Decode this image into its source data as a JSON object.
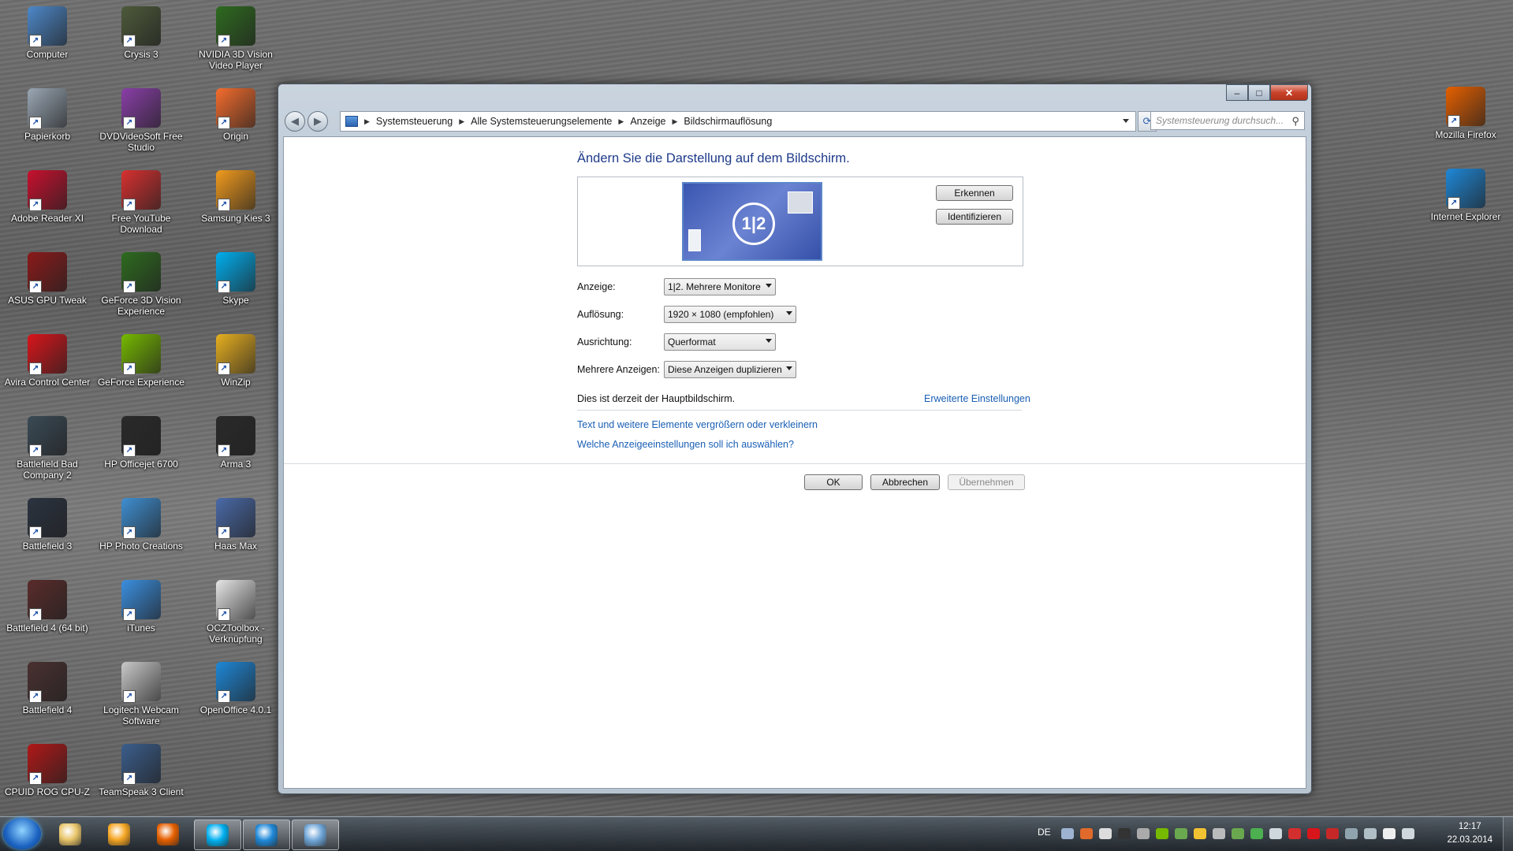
{
  "desktop": {
    "icons_col1": [
      {
        "label": "Computer",
        "icon": "computer-icon",
        "color": "#4d88c9"
      },
      {
        "label": "Papierkorb",
        "icon": "recycle-bin-icon",
        "color": "#9aa7b4"
      },
      {
        "label": "Adobe Reader XI",
        "icon": "adobe-reader-icon",
        "color": "#c8102e"
      },
      {
        "label": "ASUS GPU Tweak",
        "icon": "asus-gpu-tweak-icon",
        "color": "#8b1a1a"
      },
      {
        "label": "Avira Control Center",
        "icon": "avira-icon",
        "color": "#d8151b"
      },
      {
        "label": "Battlefield Bad Company 2",
        "icon": "battlefield-bc2-icon",
        "color": "#3a4a55"
      },
      {
        "label": "Battlefield 3",
        "icon": "battlefield-3-icon",
        "color": "#2a3340"
      },
      {
        "label": "Battlefield 4 (64 bit)",
        "icon": "battlefield-4-64-icon",
        "color": "#5a2b2b"
      },
      {
        "label": "Battlefield 4",
        "icon": "battlefield-4-icon",
        "color": "#4a3030"
      },
      {
        "label": "CPUID ROG CPU-Z",
        "icon": "cpuz-icon",
        "color": "#b01818"
      }
    ],
    "icons_col2": [
      {
        "label": "Crysis 3",
        "icon": "crysis-3-icon",
        "color": "#4d5a3a"
      },
      {
        "label": "DVDVideoSoft Free Studio",
        "icon": "dvdvideosoft-icon",
        "color": "#8a3fa8"
      },
      {
        "label": "Free YouTube Download",
        "icon": "youtube-download-icon",
        "color": "#d83030"
      },
      {
        "label": "GeForce 3D Vision Experience",
        "icon": "geforce-3d-vision-icon",
        "color": "#2e6b1f"
      },
      {
        "label": "GeForce Experience",
        "icon": "geforce-experience-icon",
        "color": "#76b900"
      },
      {
        "label": "HP Officejet 6700",
        "icon": "printer-icon",
        "color": "#2a2a2a"
      },
      {
        "label": "HP Photo Creations",
        "icon": "hp-photo-icon",
        "color": "#3f8fd2"
      },
      {
        "label": "iTunes",
        "icon": "itunes-icon",
        "color": "#3b8fe0"
      },
      {
        "label": "Logitech Webcam Software",
        "icon": "webcam-icon",
        "color": "#c9c9c9"
      },
      {
        "label": "TeamSpeak 3 Client",
        "icon": "teamspeak-icon",
        "color": "#3b5e8c"
      }
    ],
    "icons_col3": [
      {
        "label": "NVIDIA 3D Vision Video Player",
        "icon": "nvidia-3d-player-icon",
        "color": "#2e6b1f"
      },
      {
        "label": "Origin",
        "icon": "origin-icon",
        "color": "#f56c2d"
      },
      {
        "label": "Samsung Kies 3",
        "icon": "kies-icon",
        "color": "#f29b1d"
      },
      {
        "label": "Skype",
        "icon": "skype-icon",
        "color": "#00aff0"
      },
      {
        "label": "WinZip",
        "icon": "winzip-icon",
        "color": "#e8b020"
      },
      {
        "label": "Arma 3",
        "icon": "arma-3-icon",
        "color": "#2a2a2a"
      },
      {
        "label": "Haas Max",
        "icon": "haas-max-icon",
        "color": "#4a6aa8"
      },
      {
        "label": "OCZToolbox - Verknüpfung",
        "icon": "ocz-toolbox-icon",
        "color": "#e6e6e6"
      },
      {
        "label": "OpenOffice 4.0.1",
        "icon": "openoffice-icon",
        "color": "#1e88d8"
      }
    ],
    "icons_right": [
      {
        "label": "Mozilla Firefox",
        "icon": "firefox-icon",
        "color": "#e66000"
      },
      {
        "label": "Internet Explorer",
        "icon": "internet-explorer-icon",
        "color": "#1e88d8"
      }
    ]
  },
  "window": {
    "caption": {
      "minimize": "–",
      "maximize": "□",
      "close": "✕"
    },
    "nav": {
      "back": "◀",
      "forward": "▶"
    },
    "breadcrumb": [
      "Systemsteuerung",
      "Alle Systemsteuerungselemente",
      "Anzeige",
      "Bildschirmauflösung"
    ],
    "search_placeholder": "Systemsteuerung durchsuch...",
    "heading": "Ändern Sie die Darstellung auf dem Bildschirm.",
    "monitor_label": "1|2",
    "buttons": {
      "detect": "Erkennen",
      "identify": "Identifizieren"
    },
    "fields": [
      {
        "label": "Anzeige:",
        "value": "1|2. Mehrere Monitore"
      },
      {
        "label": "Auflösung:",
        "value": "1920 × 1080 (empfohlen)"
      },
      {
        "label": "Ausrichtung:",
        "value": "Querformat"
      },
      {
        "label": "Mehrere Anzeigen:",
        "value": "Diese Anzeigen duplizieren"
      }
    ],
    "main_display_text": "Dies ist derzeit der Hauptbildschirm.",
    "advanced_link": "Erweiterte Einstellungen",
    "links": [
      "Text und weitere Elemente vergrößern oder verkleinern",
      "Welche Anzeigeeinstellungen soll ich auswählen?"
    ],
    "footer": {
      "ok": "OK",
      "cancel": "Abbrechen",
      "apply": "Übernehmen"
    }
  },
  "taskbar": {
    "language": "DE",
    "time": "12:17",
    "date": "22.03.2014",
    "pinned": [
      {
        "icon": "explorer-icon",
        "color": "#e8c56a"
      },
      {
        "icon": "media-player-icon",
        "color": "#f5a623"
      },
      {
        "icon": "firefox-icon",
        "color": "#e66000"
      },
      {
        "icon": "skype-icon",
        "color": "#00aff0"
      },
      {
        "icon": "internet-explorer-icon",
        "color": "#1e88d8"
      },
      {
        "icon": "control-panel-icon",
        "color": "#6fa6d8"
      }
    ]
  }
}
